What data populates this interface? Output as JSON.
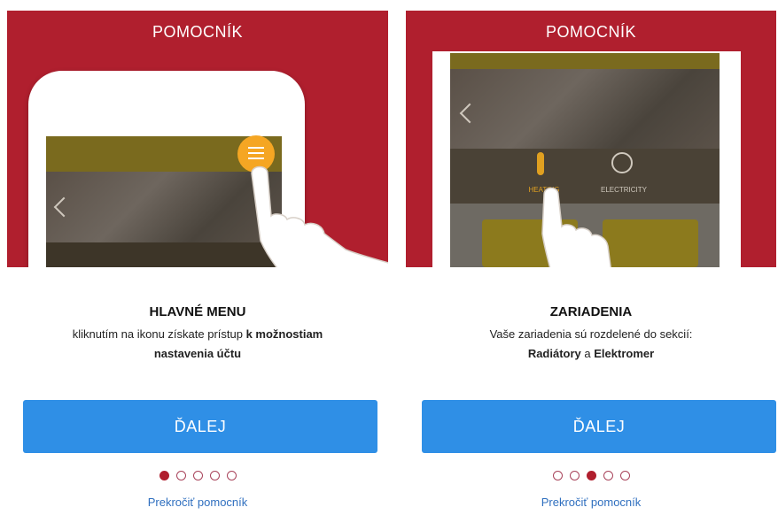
{
  "screens": [
    {
      "header_title": "POMOCNÍK",
      "step_title": "HLAVNÉ MENU",
      "desc_line1_plain": "kliknutím na ikonu získate prístup ",
      "desc_line1_bold": "k možnostiam",
      "desc_line2_bold": "nastavenia účtu",
      "next_label": "ĎALEJ",
      "skip_label": "Prekročiť pomocník",
      "active_dot": 0,
      "total_dots": 5
    },
    {
      "header_title": "POMOCNÍK",
      "step_title": "ZARIADENIA",
      "desc_line1_plain": "Vaše zariadenia sú rozdelené do sekcií:",
      "desc_line2_bold_a": "Radiátory",
      "desc_line2_plain": " a ",
      "desc_line2_bold_b": "Elektromer",
      "heating_label": "HEATING",
      "electricity_label": "ELECTRICITY",
      "next_label": "ĎALEJ",
      "skip_label": "Prekročiť pomocník",
      "active_dot": 2,
      "total_dots": 5
    }
  ],
  "colors": {
    "brand_red": "#b01f2e",
    "button_blue": "#2f8fe6",
    "link_blue": "#2f6fbf",
    "menu_orange": "#f5a623"
  }
}
